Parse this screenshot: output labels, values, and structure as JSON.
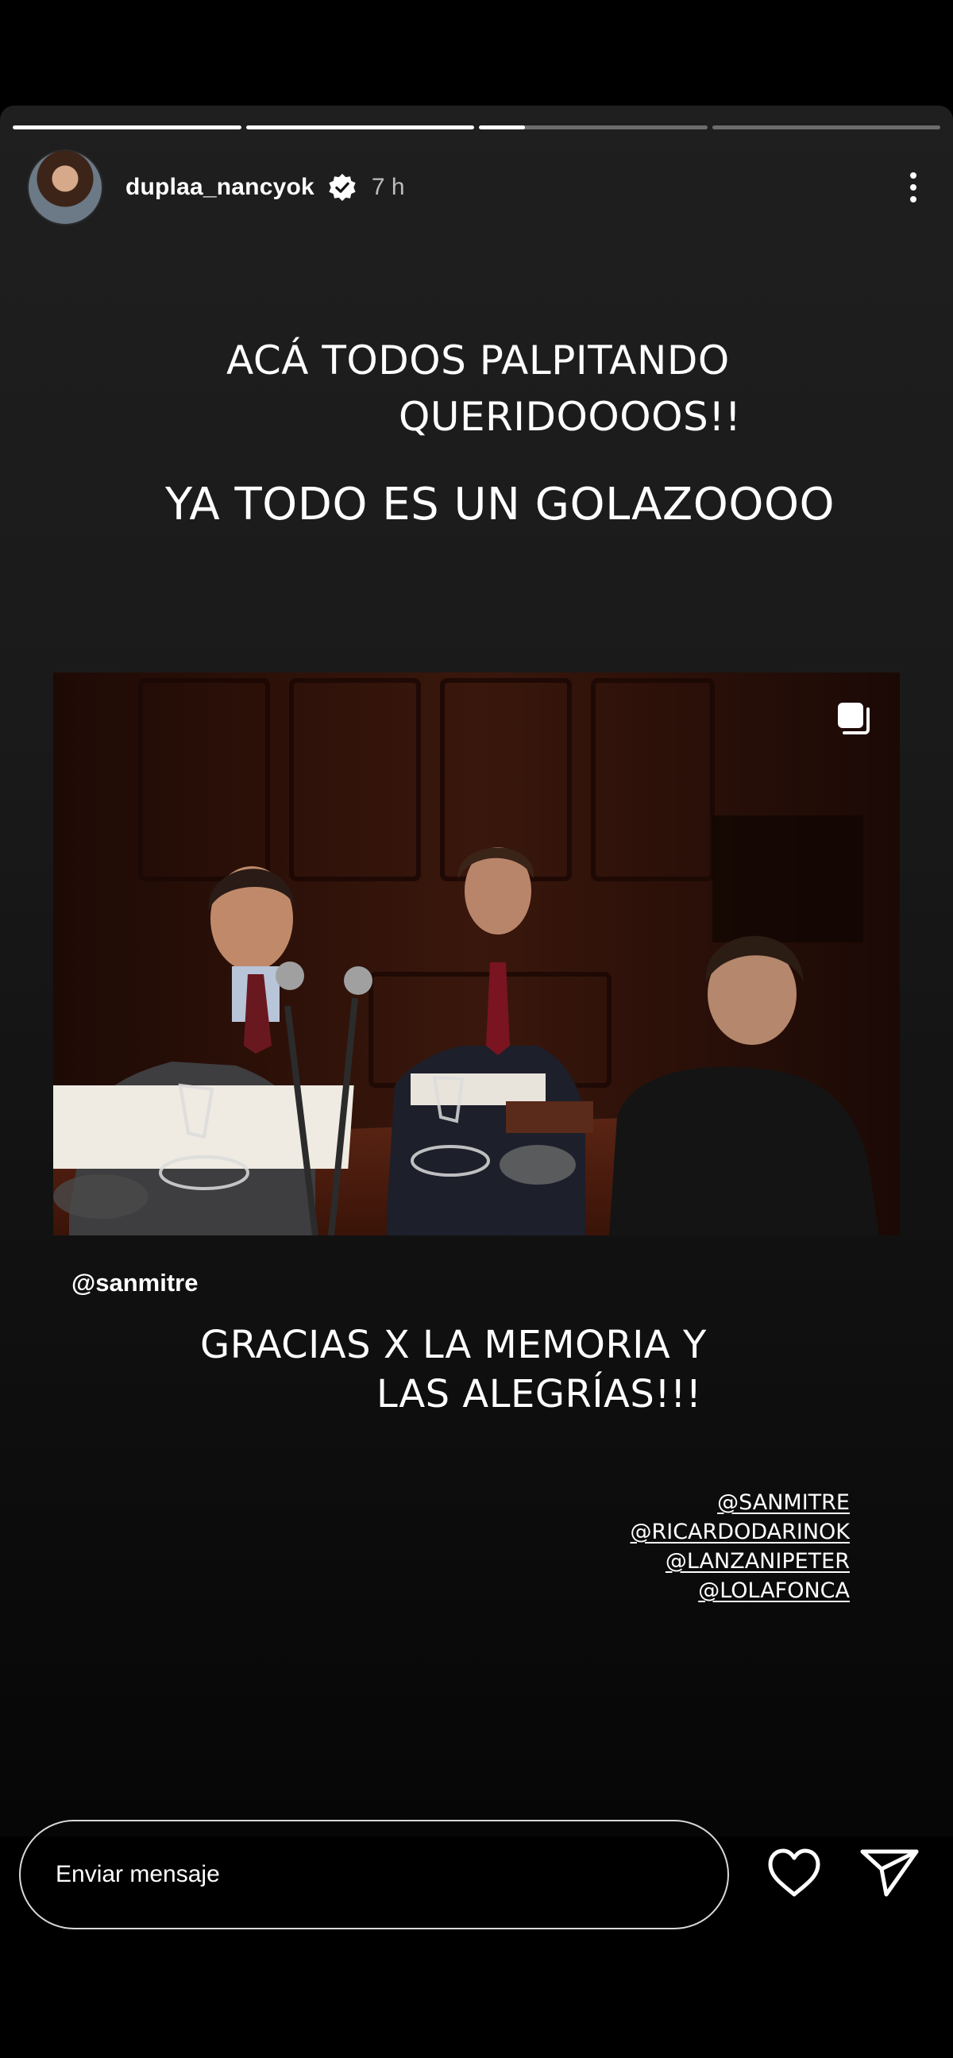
{
  "story": {
    "progress": [
      1,
      1,
      0.2,
      0
    ],
    "username": "duplaa_nancyok",
    "time": "7 h",
    "caption_top": [
      "ACÁ TODOS PALPITANDO",
      "QUERIDOOOOS!!"
    ],
    "caption_main": "YA TODO ES UN GOLAZOOOO",
    "mention_chip": "@sanmitre",
    "caption_bottom": [
      "GRACIAS X LA MEMORIA Y",
      "LAS ALEGRÍAS!!!"
    ],
    "tags": [
      "@SANMITRE",
      "@RICARDODARINOK",
      "@LANZANIPETER",
      "@LOLAFONCA"
    ]
  },
  "reply": {
    "placeholder": "Enviar mensaje"
  },
  "icons": {
    "verified": "verified-badge-icon",
    "more": "more-options-icon",
    "multi": "multiple-images-icon",
    "like": "heart-icon",
    "send": "send-icon"
  },
  "colors": {
    "background": "#1a1a1a",
    "text": "#ffffff"
  }
}
